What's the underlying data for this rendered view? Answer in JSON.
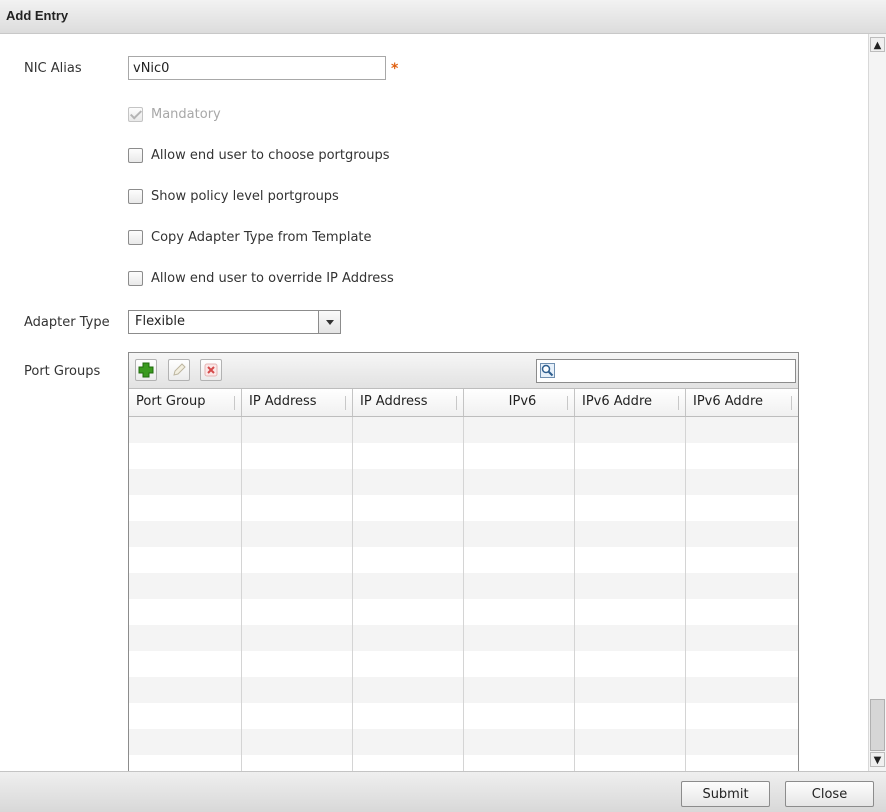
{
  "dialog": {
    "title": "Add Entry"
  },
  "form": {
    "nic_alias": {
      "label": "NIC Alias",
      "value": "vNic0",
      "required_marker": "*"
    },
    "checkboxes": [
      {
        "label": "Mandatory",
        "checked": true,
        "disabled": true
      },
      {
        "label": "Allow end user to choose portgroups",
        "checked": false,
        "disabled": false
      },
      {
        "label": "Show policy level portgroups",
        "checked": false,
        "disabled": false
      },
      {
        "label": "Copy Adapter Type from Template",
        "checked": false,
        "disabled": false
      },
      {
        "label": "Allow end user to override IP Address",
        "checked": false,
        "disabled": false
      }
    ],
    "adapter_type": {
      "label": "Adapter Type",
      "value": "Flexible"
    },
    "port_groups": {
      "label": "Port Groups",
      "toolbar_icons": [
        "add-icon",
        "edit-icon",
        "delete-icon",
        "search-icon"
      ],
      "search_value": "",
      "columns": [
        "Port Group",
        "IP Address",
        "IP Address",
        "IPv6",
        "IPv6 Addre",
        "IPv6 Addre"
      ],
      "rows": []
    }
  },
  "footer": {
    "submit_label": "Submit",
    "close_label": "Close"
  },
  "colors": {
    "required": "#e06010",
    "add_icon": "#3a9a1e",
    "delete_icon": "#d44a4a",
    "row_stripe": "#f4f4f4"
  }
}
